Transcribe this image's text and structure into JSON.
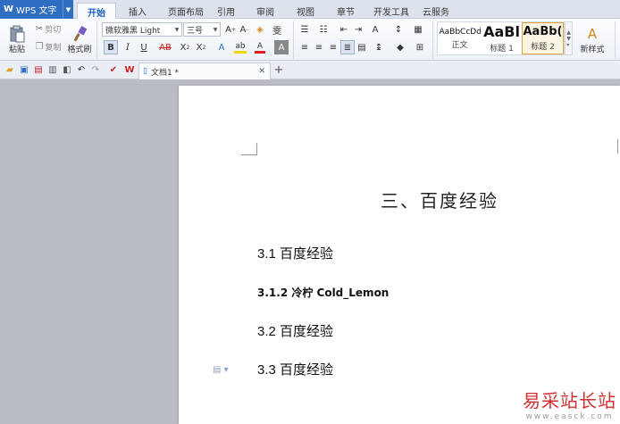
{
  "app": {
    "name": "WPS 文字"
  },
  "tabs": [
    {
      "label": "开始",
      "active": true
    },
    {
      "label": "插入"
    },
    {
      "label": "页面布局"
    },
    {
      "label": "引用"
    },
    {
      "label": "审阅"
    },
    {
      "label": "视图"
    },
    {
      "label": "章节"
    },
    {
      "label": "开发工具"
    },
    {
      "label": "云服务"
    }
  ],
  "ribbon": {
    "paste": "粘贴",
    "cut": "剪切",
    "copy": "复制",
    "format_painter": "格式刷",
    "font_name": "微软雅黑 Light",
    "font_size": "三号",
    "styles": [
      {
        "sample": "AaBbCcDd",
        "name": "正文"
      },
      {
        "sample": "AaBl",
        "name": "标题 1"
      },
      {
        "sample": "AaBb(",
        "name": "标题 2",
        "selected": true
      }
    ],
    "new_style": "新样式"
  },
  "document_tab": {
    "title": "文档1 *"
  },
  "document": {
    "title": "三、百度经验",
    "headings": [
      {
        "text": "3.1 百度经验",
        "level": 2
      },
      {
        "text": "3.1.2 冷柠 Cold_Lemon",
        "level": 3
      },
      {
        "text": "3.2 百度经验",
        "level": 2
      },
      {
        "text": "3.3 百度经验",
        "level": 2
      }
    ]
  },
  "watermark": {
    "top": "易采站长站",
    "bottom": "www.easck.com"
  },
  "colors": {
    "accent": "#2f6fc2",
    "active_tab_text": "#1a5fb4",
    "highlight": "#f2d600",
    "font_color": "#e02020"
  }
}
